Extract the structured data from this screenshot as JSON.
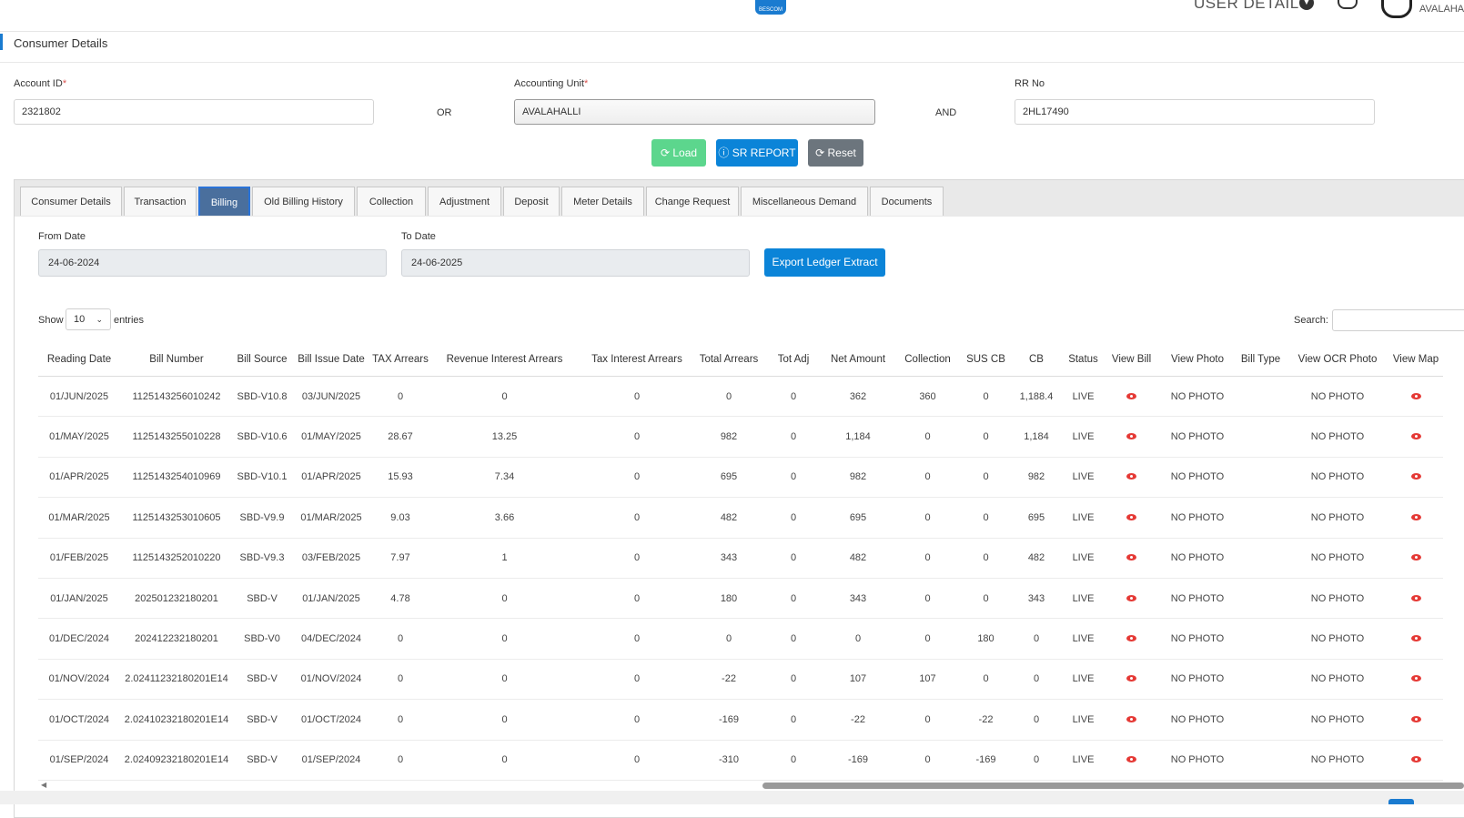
{
  "header": {
    "logo_text": "BESCOM",
    "user_details_label": "USER DETAILS",
    "user_name": "AVALAHA"
  },
  "section": {
    "title": "Consumer Details"
  },
  "search": {
    "account_id_label": "Account ID",
    "account_id_value": "2321802",
    "or_label": "OR",
    "accounting_unit_label": "Accounting Unit",
    "accounting_unit_value": "AVALAHALLI",
    "and_label": "AND",
    "rr_no_label": "RR No",
    "rr_no_value": "2HL17490",
    "required_mark": "*"
  },
  "actions": {
    "load_label": "Load",
    "sr_report_label": "SR REPORT",
    "reset_label": "Reset"
  },
  "tabs": [
    {
      "label": "Consumer Details"
    },
    {
      "label": "Transaction"
    },
    {
      "label": "Billing"
    },
    {
      "label": "Old Billing History"
    },
    {
      "label": "Collection"
    },
    {
      "label": "Adjustment"
    },
    {
      "label": "Deposit"
    },
    {
      "label": "Meter Details"
    },
    {
      "label": "Change Request"
    },
    {
      "label": "Miscellaneous Demand"
    },
    {
      "label": "Documents"
    }
  ],
  "active_tab": "Billing",
  "filters": {
    "from_date_label": "From Date",
    "from_date_value": "24-06-2024",
    "to_date_label": "To Date",
    "to_date_value": "24-06-2025",
    "export_label": "Export Ledger Extract"
  },
  "table_controls": {
    "show_label": "Show",
    "entries_value": "10",
    "entries_label": "entries",
    "search_label": "Search:"
  },
  "table": {
    "columns": [
      "Reading Date",
      "Bill Number",
      "Bill Source",
      "Bill Issue Date",
      "TAX Arrears",
      "Revenue Interest Arrears",
      "Tax Interest Arrears",
      "Total Arrears",
      "Tot Adj",
      "Net Amount",
      "Collection",
      "SUS CB",
      "CB",
      "Status",
      "View Bill",
      "View Photo",
      "Bill Type",
      "View OCR Photo",
      "View Map"
    ],
    "rows": [
      [
        "01/JUN/2025",
        "1125143256010242",
        "SBD-V10.8",
        "03/JUN/2025",
        "0",
        "0",
        "0",
        "0",
        "0",
        "362",
        "360",
        "0",
        "1,188.4",
        "LIVE",
        "eye",
        "NO PHOTO",
        "",
        "NO PHOTO",
        "eye"
      ],
      [
        "01/MAY/2025",
        "1125143255010228",
        "SBD-V10.6",
        "01/MAY/2025",
        "28.67",
        "13.25",
        "0",
        "982",
        "0",
        "1,184",
        "0",
        "0",
        "1,184",
        "LIVE",
        "eye",
        "NO PHOTO",
        "",
        "NO PHOTO",
        "eye"
      ],
      [
        "01/APR/2025",
        "1125143254010969",
        "SBD-V10.1",
        "01/APR/2025",
        "15.93",
        "7.34",
        "0",
        "695",
        "0",
        "982",
        "0",
        "0",
        "982",
        "LIVE",
        "eye",
        "NO PHOTO",
        "",
        "NO PHOTO",
        "eye"
      ],
      [
        "01/MAR/2025",
        "1125143253010605",
        "SBD-V9.9",
        "01/MAR/2025",
        "9.03",
        "3.66",
        "0",
        "482",
        "0",
        "695",
        "0",
        "0",
        "695",
        "LIVE",
        "eye",
        "NO PHOTO",
        "",
        "NO PHOTO",
        "eye"
      ],
      [
        "01/FEB/2025",
        "1125143252010220",
        "SBD-V9.3",
        "03/FEB/2025",
        "7.97",
        "1",
        "0",
        "343",
        "0",
        "482",
        "0",
        "0",
        "482",
        "LIVE",
        "eye",
        "NO PHOTO",
        "",
        "NO PHOTO",
        "eye"
      ],
      [
        "01/JAN/2025",
        "202501232180201",
        "SBD-V",
        "01/JAN/2025",
        "4.78",
        "0",
        "0",
        "180",
        "0",
        "343",
        "0",
        "0",
        "343",
        "LIVE",
        "eye",
        "NO PHOTO",
        "",
        "NO PHOTO",
        "eye"
      ],
      [
        "01/DEC/2024",
        "202412232180201",
        "SBD-V0",
        "04/DEC/2024",
        "0",
        "0",
        "0",
        "0",
        "0",
        "0",
        "0",
        "180",
        "0",
        "LIVE",
        "eye",
        "NO PHOTO",
        "",
        "NO PHOTO",
        "eye"
      ],
      [
        "01/NOV/2024",
        "2.02411232180201E14",
        "SBD-V",
        "01/NOV/2024",
        "0",
        "0",
        "0",
        "-22",
        "0",
        "107",
        "107",
        "0",
        "0",
        "LIVE",
        "eye",
        "NO PHOTO",
        "",
        "NO PHOTO",
        "eye"
      ],
      [
        "01/OCT/2024",
        "2.02410232180201E14",
        "SBD-V",
        "01/OCT/2024",
        "0",
        "0",
        "0",
        "-169",
        "0",
        "-22",
        "0",
        "-22",
        "0",
        "LIVE",
        "eye",
        "NO PHOTO",
        "",
        "NO PHOTO",
        "eye"
      ],
      [
        "01/SEP/2024",
        "2.02409232180201E14",
        "SBD-V",
        "01/SEP/2024",
        "0",
        "0",
        "0",
        "-310",
        "0",
        "-169",
        "0",
        "-169",
        "0",
        "LIVE",
        "eye",
        "NO PHOTO",
        "",
        "NO PHOTO",
        "eye"
      ]
    ]
  },
  "colors": {
    "primary": "#0b84d8",
    "load": "#5cd68d",
    "reset": "#6c757d",
    "active_tab": "#4a6f9d",
    "eye_icon": "#e53935"
  }
}
